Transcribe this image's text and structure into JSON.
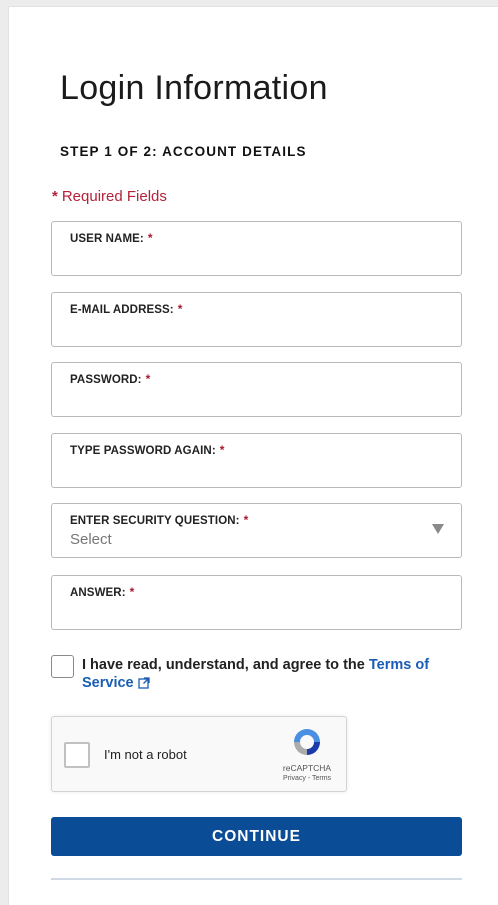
{
  "header": {
    "title": "Login Information",
    "step": "STEP 1 OF 2: ACCOUNT DETAILS"
  },
  "required_note": {
    "star": "*",
    "text": "Required Fields"
  },
  "fields": {
    "username": {
      "label": "USER NAME:",
      "value": ""
    },
    "email": {
      "label": "E-MAIL ADDRESS:",
      "value": ""
    },
    "password": {
      "label": "PASSWORD:",
      "value": ""
    },
    "password_again": {
      "label": "TYPE PASSWORD AGAIN:",
      "value": ""
    },
    "security_question": {
      "label": "ENTER SECURITY QUESTION:",
      "selected": "Select"
    },
    "answer": {
      "label": "ANSWER:",
      "value": ""
    }
  },
  "asterisk": "*",
  "tos": {
    "text": "I have read, understand, and agree to the ",
    "link": "Terms of Service",
    "checked": false
  },
  "recaptcha": {
    "label": "I'm not a robot",
    "brand": "reCAPTCHA",
    "links": "Privacy - Terms"
  },
  "continue_label": "CONTINUE",
  "colors": {
    "required": "#b3223a",
    "link": "#1a5db4",
    "button": "#0a4c96"
  }
}
